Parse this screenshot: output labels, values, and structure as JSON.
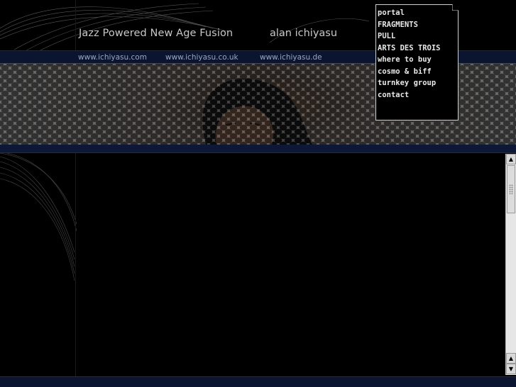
{
  "header": {
    "tagline": "Jazz Powered New Age Fusion",
    "artist": "alan ichiyasu"
  },
  "sites": [
    {
      "label": "www.ichiyasu.com"
    },
    {
      "label": "www.ichiyasu.co.uk"
    },
    {
      "label": "www.ichiyasu.de"
    }
  ],
  "menu": {
    "items": [
      {
        "label": "portal"
      },
      {
        "label": "FRAGMENTS"
      },
      {
        "label": "PULL"
      },
      {
        "label": "ARTS DES TROIS"
      },
      {
        "label": "where to buy"
      },
      {
        "label": "cosmo & biff"
      },
      {
        "label": "turnkey group"
      },
      {
        "label": "contact"
      }
    ]
  },
  "scrollbar": {
    "up_glyph": "▲",
    "down_glyph": "▼",
    "position": 0
  },
  "colors": {
    "background": "#000000",
    "bar_blue": "#0b1530",
    "text": "#c8c8c8",
    "link": "#9aa6c2"
  }
}
